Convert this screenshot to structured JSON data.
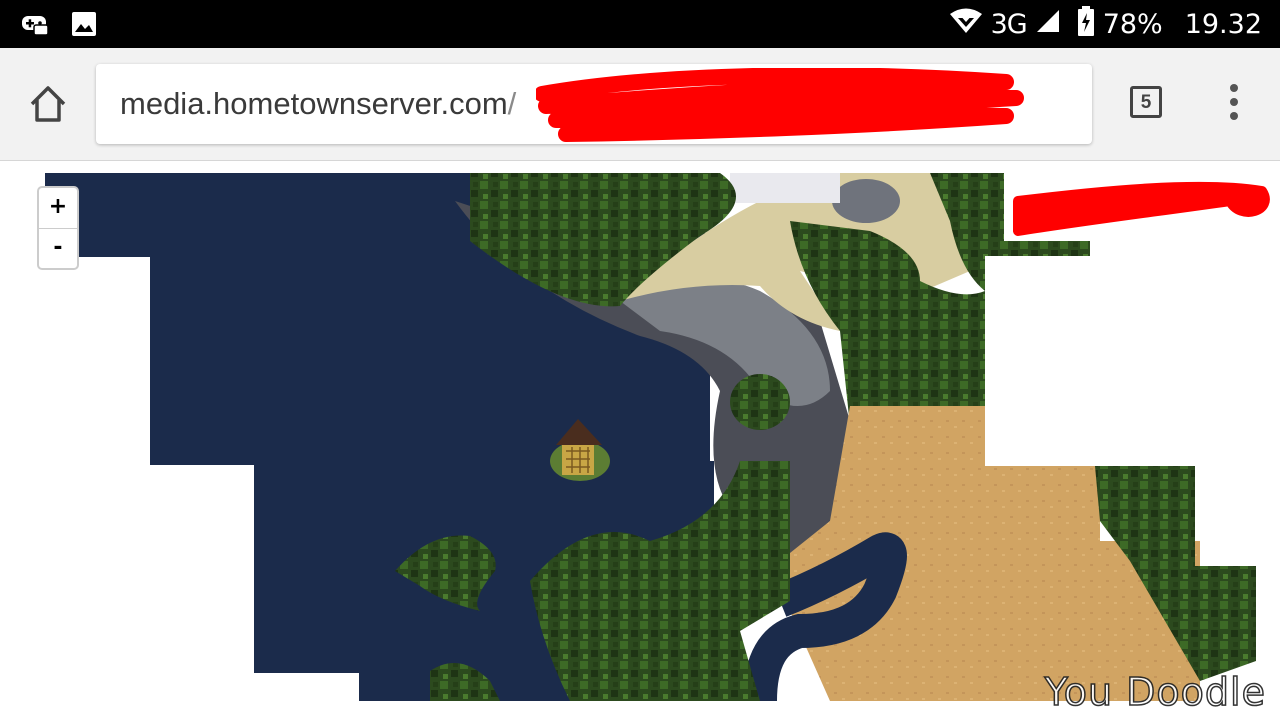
{
  "status_bar": {
    "network": "3G",
    "battery": "78%",
    "time": "19.32",
    "icons": [
      "game-controller-icon",
      "image-icon",
      "wifi-icon",
      "signal-icon",
      "battery-charging-icon"
    ]
  },
  "browser": {
    "url_domain": "media.hometownserver.com",
    "url_path": "/",
    "tab_count": "5",
    "icons": [
      "home-icon",
      "tab-switcher-icon",
      "overflow-menu-icon"
    ]
  },
  "map": {
    "zoom_in_label": "+",
    "zoom_out_label": "-",
    "colors": {
      "water": "#1a2a4a",
      "forest": "#2d4a1f",
      "sand": "#d3a764",
      "beach": "#d9cfa4",
      "stone": "#7b7f86",
      "snow": "#eeeeee",
      "redaction": "#ff0000"
    }
  },
  "watermark": "You Doodle"
}
